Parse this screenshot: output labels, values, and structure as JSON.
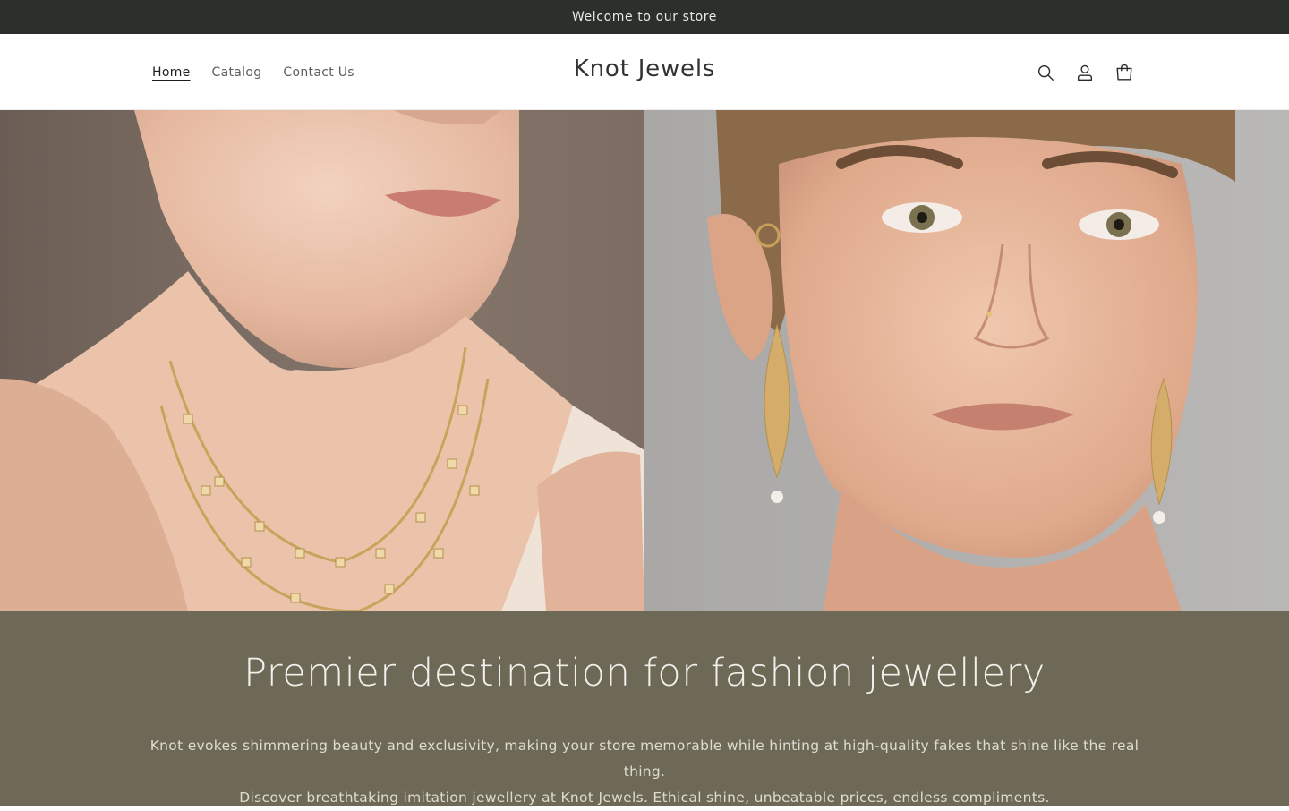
{
  "announcement": {
    "text": "Welcome to our store"
  },
  "header": {
    "nav": [
      {
        "label": "Home",
        "active": true
      },
      {
        "label": "Catalog",
        "active": false
      },
      {
        "label": "Contact Us",
        "active": false
      }
    ],
    "logo": "Knot Jewels",
    "icons": [
      "search-icon",
      "account-icon",
      "cart-icon"
    ]
  },
  "hero": {
    "images": [
      "necklace-model-photo",
      "earring-model-photo"
    ]
  },
  "banner": {
    "heading": "Premier destination for fashion jewellery",
    "line1": "Knot evokes shimmering beauty and exclusivity, making your store memorable while hinting at high-quality fakes that shine like the real thing.",
    "line2": "Discover breathtaking imitation jewellery at Knot Jewels. Ethical shine, unbeatable prices, endless compliments."
  },
  "colors": {
    "announcement_bg": "#2b302d",
    "banner_bg": "#6e6957"
  }
}
